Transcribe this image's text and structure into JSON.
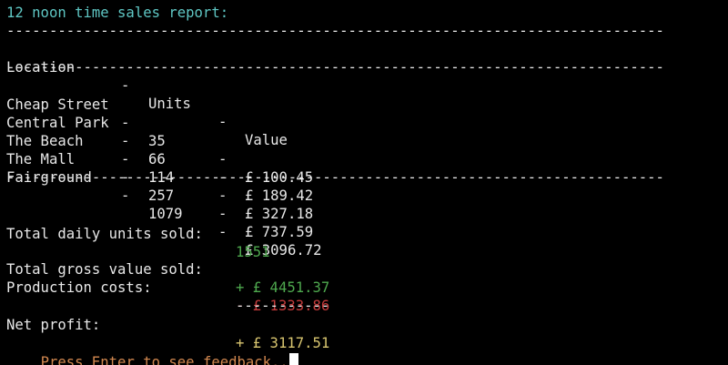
{
  "title": "12 noon time sales report:",
  "rule": "-----------------------------------------------------------------------------",
  "table": {
    "headers": {
      "location": "Location",
      "sep": "-",
      "units": "Units",
      "value": "Value"
    },
    "rows": [
      {
        "location": "Cheap Street",
        "units": "35",
        "value": "£ 100.45"
      },
      {
        "location": "Central Park",
        "units": "66",
        "value": "£ 189.42"
      },
      {
        "location": "The Beach",
        "units": "114",
        "value": "£ 327.18"
      },
      {
        "location": "The Mall",
        "units": "257",
        "value": "£ 737.59"
      },
      {
        "location": "Fairground",
        "units": "1079",
        "value": "£ 3096.72"
      }
    ]
  },
  "totals": {
    "units_label": "Total daily units sold:",
    "units_value": "1551",
    "gross_label": "Total gross value sold:",
    "gross_value": "+ £ 4451.37",
    "costs_label": "Production costs:",
    "costs_value": "- £ 1333.86",
    "subtotal_rule": "-----------",
    "net_label": "Net profit:",
    "net_value": "+ £ 3117.51"
  },
  "prompt": "Press Enter to see feedback..",
  "colors": {
    "background": "#000000",
    "text": "#e8e8e8",
    "title": "#5fc7c4",
    "positive": "#4ea84e",
    "negative": "#c43b3b",
    "net": "#d9c670",
    "prompt": "#d1874f"
  }
}
